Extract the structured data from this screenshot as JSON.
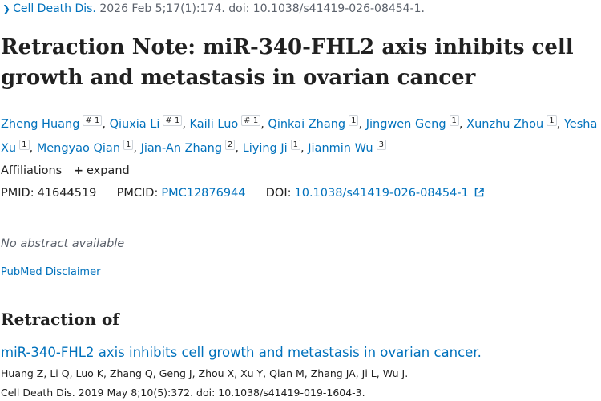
{
  "citation": {
    "journal": "Cell Death Dis.",
    "details": "2026 Feb 5;17(1):174. doi: 10.1038/s41419-026-08454-1."
  },
  "title": "Retraction Note: miR-340-FHL2 axis inhibits cell growth and metastasis in ovarian cancer",
  "authors": [
    {
      "name": "Zheng Huang",
      "marks": "# 1"
    },
    {
      "name": "Qiuxia Li",
      "marks": "# 1"
    },
    {
      "name": "Kaili Luo",
      "marks": "# 1"
    },
    {
      "name": "Qinkai Zhang",
      "marks": "1"
    },
    {
      "name": "Jingwen Geng",
      "marks": "1"
    },
    {
      "name": "Xunzhu Zhou",
      "marks": "1"
    },
    {
      "name": "Yesha Xu",
      "marks": "1"
    },
    {
      "name": "Mengyao Qian",
      "marks": "1"
    },
    {
      "name": "Jian-An Zhang",
      "marks": "2"
    },
    {
      "name": "Liying Ji",
      "marks": "1"
    },
    {
      "name": "Jianmin Wu",
      "marks": "3"
    }
  ],
  "affiliations": {
    "label": "Affiliations",
    "expand_label": "expand"
  },
  "identifiers": {
    "pmid_label": "PMID:",
    "pmid": "41644519",
    "pmcid_label": "PMCID:",
    "pmcid": "PMC12876944",
    "doi_label": "DOI:",
    "doi": "10.1038/s41419-026-08454-1"
  },
  "no_abstract": "No abstract available",
  "disclaimer": "PubMed Disclaimer",
  "retraction": {
    "heading": "Retraction of",
    "ref_title": "miR-340-FHL2 axis inhibits cell growth and metastasis in ovarian cancer.",
    "ref_authors": "Huang Z, Li Q, Luo K, Zhang Q, Geng J, Zhou X, Xu Y, Qian M, Zhang JA, Ji L, Wu J.",
    "ref_citation": "Cell Death Dis. 2019 May 8;10(5):372. doi: 10.1038/s41419-019-1604-3."
  },
  "colors": {
    "link": "#0071bc",
    "text": "#212121",
    "muted": "#5b616b"
  },
  "icons": {
    "citation": "chevron-right-icon",
    "expand": "plus-icon",
    "doi": "external-link-icon"
  }
}
